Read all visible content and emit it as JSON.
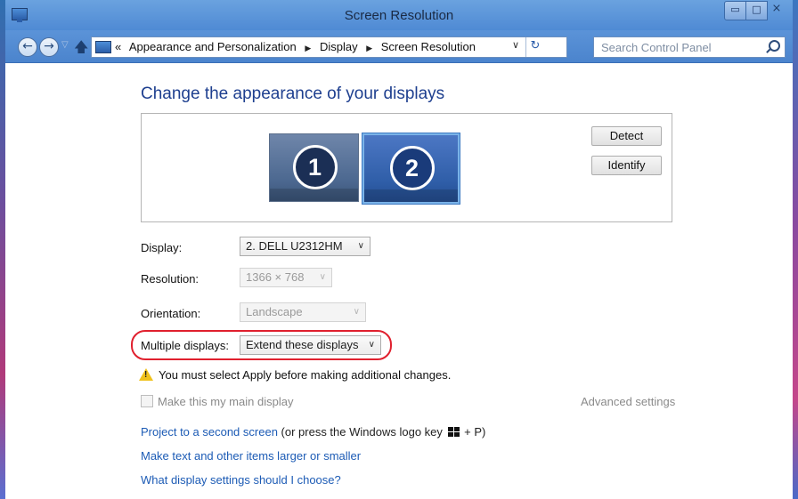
{
  "window": {
    "title": "Screen Resolution",
    "controls": {
      "minimize": "▭",
      "maximize": "□",
      "close": "⨯"
    }
  },
  "nav": {
    "breadcrumb_prefix": "«",
    "breadcrumbs": [
      "Appearance and Personalization",
      "Display",
      "Screen Resolution"
    ],
    "search_placeholder": "Search Control Panel"
  },
  "main": {
    "heading": "Change the appearance of your displays",
    "monitors": [
      "1",
      "2"
    ],
    "detect_label": "Detect",
    "identify_label": "Identify",
    "display_label": "Display:",
    "display_value": "2. DELL U2312HM",
    "resolution_label": "Resolution:",
    "resolution_value": "1366 × 768",
    "orientation_label": "Orientation:",
    "orientation_value": "Landscape",
    "multiple_label": "Multiple displays:",
    "multiple_value": "Extend these displays",
    "warning": "You must select Apply before making additional changes.",
    "main_display_label": "Make this my main display",
    "advanced_label": "Advanced settings",
    "project_link": "Project to a second screen",
    "project_note_before": " (or press the Windows logo key ",
    "project_note_after": " + P)",
    "larger_link": "Make text and other items larger or smaller",
    "choose_link": "What display settings should I choose?"
  },
  "colors": {
    "link": "#1c5bb5",
    "heading": "#1e3f8f",
    "highlight": "#e0202e",
    "titlebar": "#5b93d8"
  }
}
